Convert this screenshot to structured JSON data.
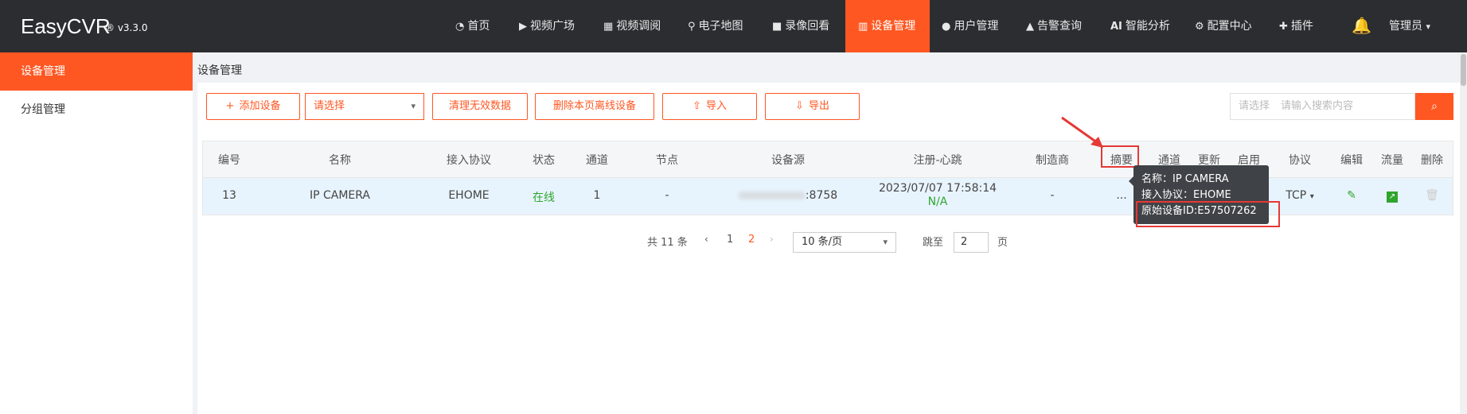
{
  "brand": {
    "name": "EasyCVR",
    "version": "® v3.3.0"
  },
  "nav": [
    {
      "label": "首页",
      "icon": "dashboard-icon"
    },
    {
      "label": "视频广场",
      "icon": "play-icon"
    },
    {
      "label": "视频调阅",
      "icon": "grid-icon"
    },
    {
      "label": "电子地图",
      "icon": "map-pin-icon"
    },
    {
      "label": "录像回看",
      "icon": "video-camera-icon"
    },
    {
      "label": "设备管理",
      "icon": "device-icon",
      "active": true
    },
    {
      "label": "用户管理",
      "icon": "user-icon"
    },
    {
      "label": "告警查询",
      "icon": "alarm-icon"
    },
    {
      "label": "智能分析",
      "icon": "ai-icon"
    },
    {
      "label": "配置中心",
      "icon": "gear-icon"
    },
    {
      "label": "插件",
      "icon": "puzzle-icon"
    }
  ],
  "user": {
    "label": "管理员"
  },
  "sidebar": {
    "items": [
      {
        "label": "设备管理",
        "active": true
      },
      {
        "label": "分组管理"
      }
    ]
  },
  "breadcrumb": "设备管理",
  "toolbar": {
    "add": "添加设备",
    "select": "请选择",
    "clear": "清理无效数据",
    "delete_offline": "删除本页离线设备",
    "import": "导入",
    "export": "导出",
    "search_select": "请选择",
    "search_placeholder": "请输入搜索内容"
  },
  "table": {
    "headers": [
      "编号",
      "名称",
      "接入协议",
      "状态",
      "通道",
      "节点",
      "设备源",
      "注册-心跳",
      "制造商",
      "摘要",
      "通道",
      "更新",
      "启用",
      "协议",
      "编辑",
      "流量",
      "删除"
    ],
    "row": {
      "id": "13",
      "name": "IP CAMERA",
      "protocol": "EHOME",
      "status": "在线",
      "channels": "1",
      "node": "-",
      "source_port": ":8758",
      "register_time": "2023/07/07 17:58:14",
      "heartbeat": "N/A",
      "manufacturer": "-",
      "summary": "...",
      "transport": "TCP"
    }
  },
  "tooltip": {
    "name": "名称：IP CAMERA",
    "protocol": "接入协议：EHOME",
    "device_id": "原始设备ID:E57507262"
  },
  "pagination": {
    "total": "共 11 条",
    "pages": [
      "1",
      "2"
    ],
    "current_page": "2",
    "page_size": "10 条/页",
    "jump_label": "跳至",
    "jump_value": "2",
    "page_unit": "页"
  },
  "colors": {
    "accent": "#ff5722",
    "topbar": "#2b2d30",
    "online": "#2fa52f",
    "highlight": "#e53935"
  }
}
